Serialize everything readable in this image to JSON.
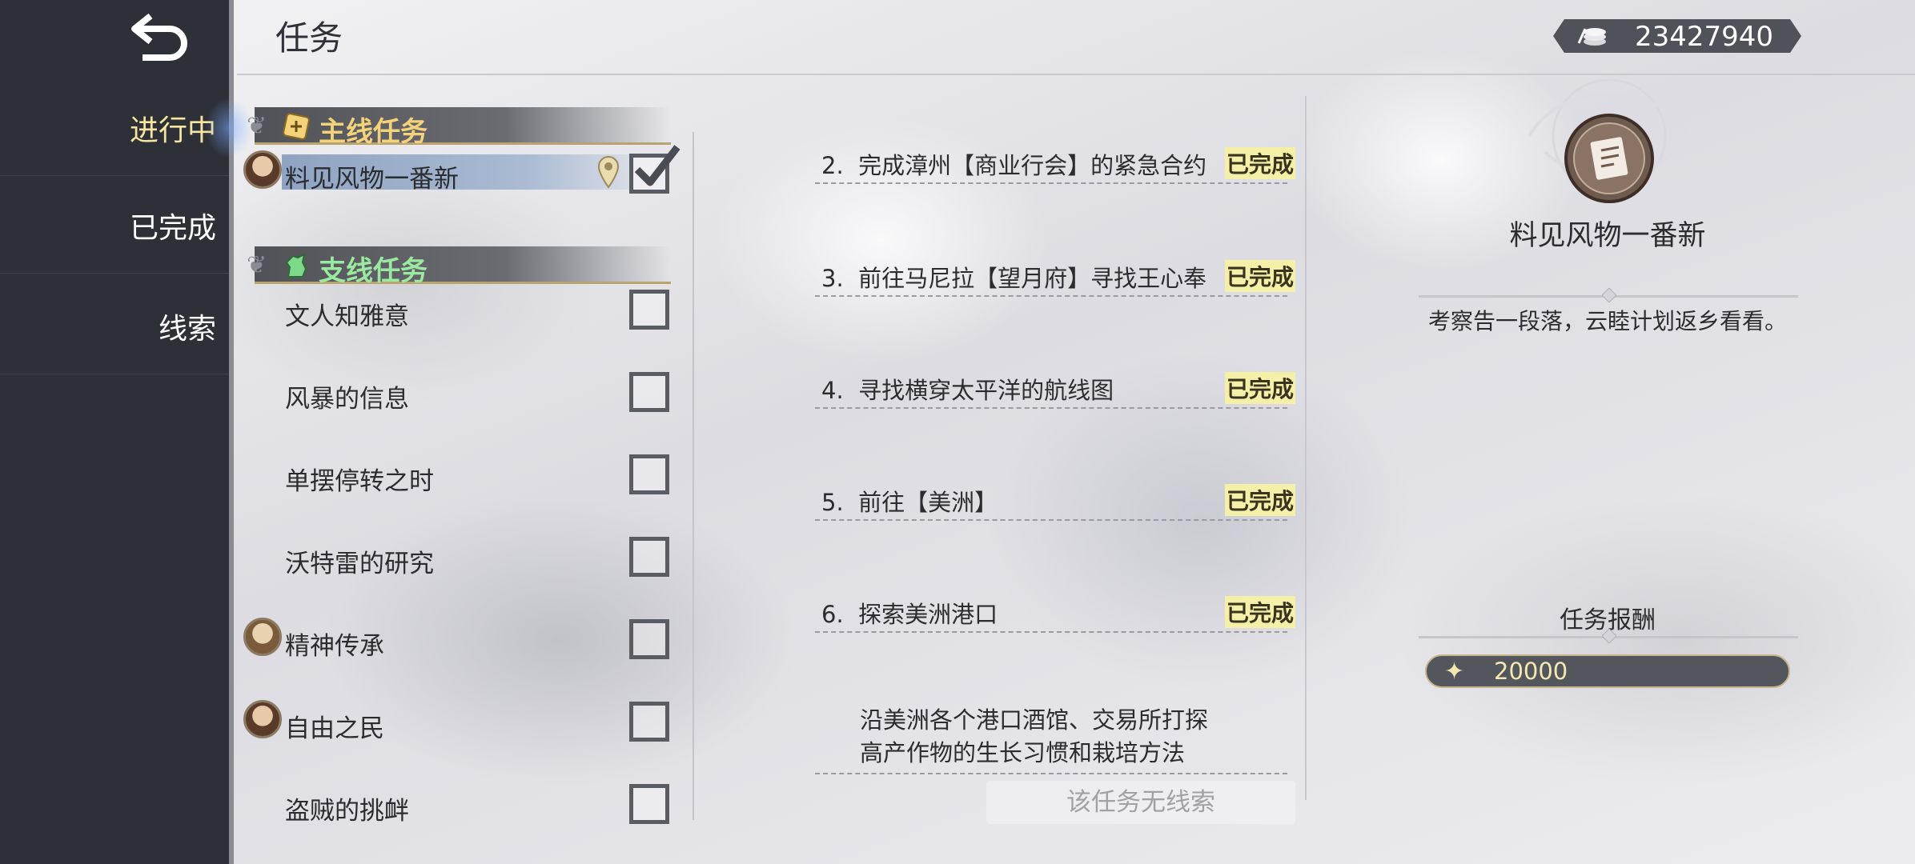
{
  "header": {
    "title": "任务",
    "currency": "23427940",
    "currency_icon": "coin-stack-icon"
  },
  "nav": {
    "back_icon": "back-arrow-icon",
    "items": [
      {
        "label": "进行中",
        "active": true
      },
      {
        "label": "已完成",
        "active": false
      },
      {
        "label": "线索",
        "active": false
      }
    ]
  },
  "quests": {
    "main_section": "主线任务",
    "side_section": "支线任务",
    "main": [
      {
        "name": "料见风物一番新",
        "selected": true,
        "checked": true,
        "pinned": true,
        "avatar": true
      }
    ],
    "side": [
      {
        "name": "文人知雅意",
        "checked": false,
        "avatar": false
      },
      {
        "name": "风暴的信息",
        "checked": false,
        "avatar": false
      },
      {
        "name": "单摆停转之时",
        "checked": false,
        "avatar": false
      },
      {
        "name": "沃特雷的研究",
        "checked": false,
        "avatar": false
      },
      {
        "name": "精神传承",
        "checked": false,
        "avatar": true
      },
      {
        "name": "自由之民",
        "checked": false,
        "avatar": true
      },
      {
        "name": "盗贼的挑衅",
        "checked": false,
        "avatar": false
      }
    ]
  },
  "objectives": [
    {
      "num": "2.",
      "text": "完成漳州【商业行会】的紧急合约",
      "status": "已完成"
    },
    {
      "num": "3.",
      "text": "前往马尼拉【望月府】寻找王心奉",
      "status": "已完成"
    },
    {
      "num": "4.",
      "text": "寻找横穿太平洋的航线图",
      "status": "已完成"
    },
    {
      "num": "5.",
      "text": "前往【美洲】",
      "status": "已完成"
    },
    {
      "num": "6.",
      "text": "探索美洲港口",
      "status": "已完成"
    }
  ],
  "current_objective": {
    "line1": "沿美洲各个港口酒馆、交易所打探",
    "line2": "高产作物的生长习惯和栽培方法"
  },
  "no_clue_button": "该任务无线索",
  "detail": {
    "title": "料见风物一番新",
    "description": "考察告一段落，云睦计划返乡看看。",
    "reward_title": "任务报酬",
    "reward_value": "20000",
    "reward_icon": "sparkle-star-icon",
    "accent": "#f3d27a",
    "side_accent": "#9be8a0",
    "status_bg": "#f4f0a8"
  }
}
